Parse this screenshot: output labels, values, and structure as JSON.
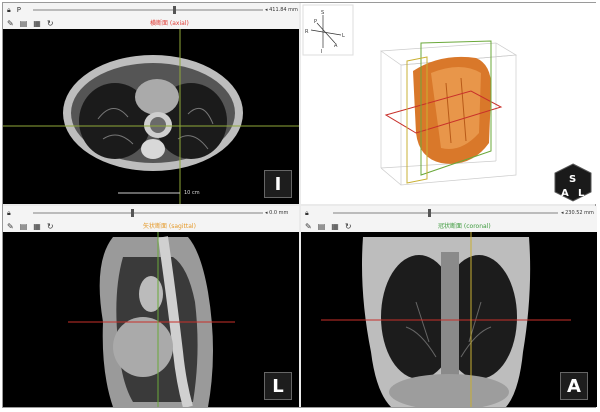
{
  "views": {
    "top_left": {
      "slider_value": "◂ 411.84 mm",
      "title": "横断面 (axial)",
      "title_color": "#e0403a",
      "orientation": "I",
      "scale": "10 cm"
    },
    "top_right": {
      "orientation_cube": {
        "labels": [
          "S",
          "A",
          "L"
        ]
      },
      "compass": {
        "S": "S",
        "R": "R",
        "L": "L",
        "P": "P",
        "A": "A",
        "I": "I"
      }
    },
    "bottom_left": {
      "slider_value": "◂ 0.0 mm",
      "title": "矢状断面 (sagittal)",
      "title_color": "#e59a2a",
      "orientation": "L"
    },
    "bottom_right": {
      "slider_value": "◂ 230.52 mm",
      "title": "冠状断面 (coronal)",
      "title_color": "#3c9a3c",
      "orientation": "A"
    }
  },
  "colors": {
    "axial_line": "#8fa83a",
    "red_line": "#c8302a",
    "green_line": "#6aa83a",
    "bone_orange": "#d9782a"
  }
}
